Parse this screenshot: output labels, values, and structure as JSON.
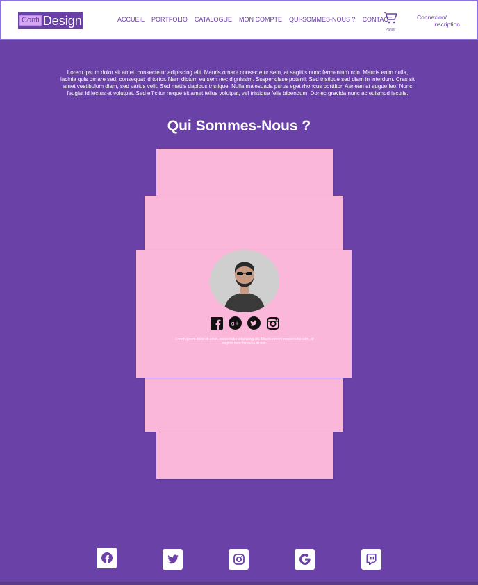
{
  "brand": {
    "logo_part1": "Conti",
    "logo_part2": "Design"
  },
  "nav": {
    "items": [
      "ACCUEIL",
      "PORTFOLIO",
      "CATALOGUE",
      "MON COMPTE",
      "QUI-SOMMES-NOUS ?",
      "CONTACT"
    ]
  },
  "cart": {
    "label": "Panier"
  },
  "auth": {
    "login": "Connexion/",
    "register": "Inscription"
  },
  "intro": {
    "text": "Lorem ipsum dolor sit amet, consectetur adipiscing elit. Mauris ornare consectetur sem, at sagittis nunc fermentum non. Mauris enim nulla, lacinia quis ornare sed, consequat id tortor. Nam dictum eu sem nec dignissim. Suspendisse potenti. Sed tristique sed diam in interdum. Cras sit amet vestibulum diam, sed varius velit. Sed mattis dapibus tristique. Nulla malesuada purus eget rhoncus porttitor. Aenean at augue leo. Nunc feugiat id lectus et volutpat. Sed efficitur neque sit amet tellus volutpat, vel tristique felis bibendum. Donec gravida nunc ac euismod iaculis."
  },
  "section": {
    "title": "Qui Sommes-Nous ?"
  },
  "profile": {
    "bio": "Lorem ipsum dolor sit amet, consectetur adipiscing elit. Mauris ornare consectetur sem, at sagittis nunc fermentum non.",
    "socials": [
      "facebook-icon",
      "google-plus-icon",
      "twitter-icon",
      "instagram-icon"
    ]
  },
  "footer": {
    "socials": [
      "facebook-icon",
      "twitter-icon",
      "instagram-icon",
      "google-icon",
      "twitch-icon"
    ]
  },
  "colors": {
    "background": "#6a41a6",
    "card": "#fbb7da",
    "header": "#ffffff",
    "accent": "#8d73e0"
  }
}
